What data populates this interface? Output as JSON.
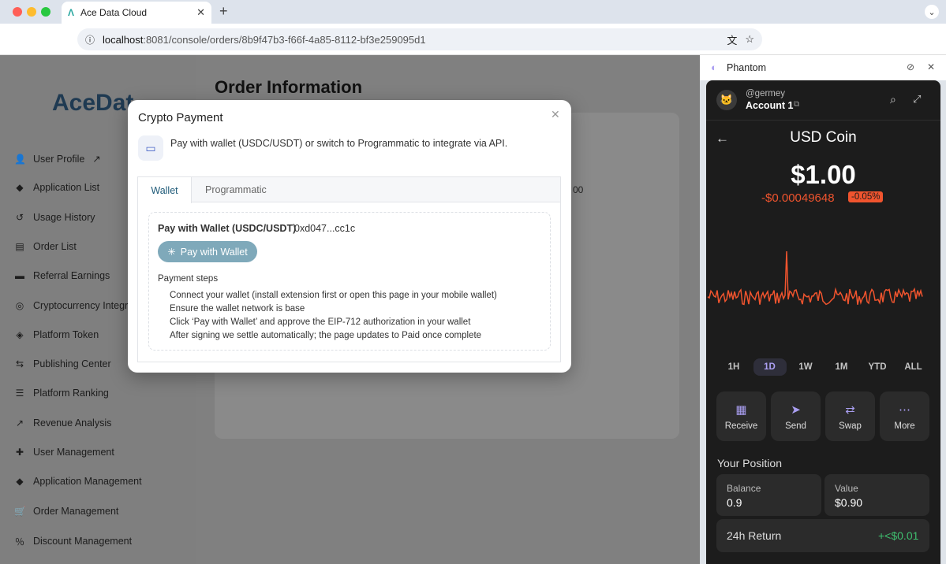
{
  "browser": {
    "tab_title": "Ace Data Cloud",
    "url_host": "localhost",
    "url_rest": ":8081/console/orders/8b9f47b3-f66f-4a85-8112-bf3e259095d1"
  },
  "sidebar": {
    "logo": "AceDat",
    "items": [
      {
        "label": "User Profile",
        "icon": "user-icon"
      },
      {
        "label": "Application List",
        "icon": "box-icon"
      },
      {
        "label": "Usage History",
        "icon": "history-icon"
      },
      {
        "label": "Order List",
        "icon": "order-icon"
      },
      {
        "label": "Referral Earnings",
        "icon": "wallet-icon"
      },
      {
        "label": "Cryptocurrency Integra",
        "icon": "crypto-icon"
      },
      {
        "label": "Platform Token",
        "icon": "shield-icon"
      },
      {
        "label": "Publishing Center",
        "icon": "publish-icon"
      },
      {
        "label": "Platform Ranking",
        "icon": "list-icon"
      },
      {
        "label": "Revenue Analysis",
        "icon": "chart-icon"
      },
      {
        "label": "User Management",
        "icon": "user-plus-icon"
      },
      {
        "label": "Application Management",
        "icon": "box-icon"
      },
      {
        "label": "Order Management",
        "icon": "cart-icon"
      },
      {
        "label": "Discount Management",
        "icon": "percent-icon"
      }
    ]
  },
  "page": {
    "title": "Order Information",
    "partial_value": "00"
  },
  "modal": {
    "title": "Crypto Payment",
    "description": "Pay with wallet (USDC/USDT) or switch to Programmatic to integrate via API.",
    "tabs": [
      "Wallet",
      "Programmatic"
    ],
    "pay_label": "Pay with Wallet (USDC/USDT)",
    "wallet_address": "0xd047...cc1c",
    "pay_button": "Pay with Wallet",
    "steps_title": "Payment steps",
    "steps": [
      "Connect your wallet (install extension first or open this page in your mobile wallet)",
      "Ensure the wallet network is base",
      "Click ‘Pay with Wallet’ and approve the EIP-712 authorization in your wallet",
      "After signing we settle automatically; the page updates to Paid once complete"
    ]
  },
  "phantom": {
    "header": "Phantom",
    "username": "@germey",
    "account": "Account 1",
    "token": "USD Coin",
    "price": "$1.00",
    "change": "-$0.00049648",
    "change_pct": "-0.05%",
    "ranges": [
      "1H",
      "1D",
      "1W",
      "1M",
      "YTD",
      "ALL"
    ],
    "selected_range": "1D",
    "actions": [
      "Receive",
      "Send",
      "Swap",
      "More"
    ],
    "position_title": "Your Position",
    "balance_label": "Balance",
    "balance": "0.9",
    "value_label": "Value",
    "value": "$0.90",
    "return_label": "24h Return",
    "return_value": "+<$0.01",
    "colors": {
      "negative": "#f0542e",
      "positive": "#3fbf6f",
      "accent": "#ab9ff2"
    }
  }
}
